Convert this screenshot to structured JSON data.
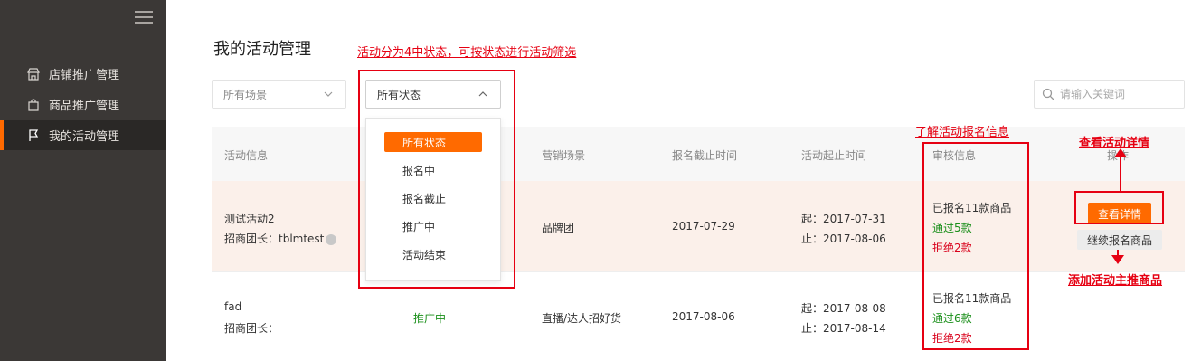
{
  "sidebar": {
    "items": [
      {
        "label": "店铺推广管理",
        "icon": "store-icon"
      },
      {
        "label": "商品推广管理",
        "icon": "bag-icon"
      },
      {
        "label": "我的活动管理",
        "icon": "flag-icon"
      }
    ]
  },
  "page": {
    "title": "我的活动管理"
  },
  "annotations": {
    "filter_note": "活动分为4中状态，可按状态进行活动筛选",
    "audit_note": "了解活动报名信息",
    "detail_note": "查看活动详情",
    "add_note": "添加活动主推商品"
  },
  "filters": {
    "scene": "所有场景",
    "status": "所有状态",
    "search_placeholder": "请输入关键词"
  },
  "status_options": [
    "所有状态",
    "报名中",
    "报名截止",
    "推广中",
    "活动结束"
  ],
  "table": {
    "headers": {
      "info": "活动信息",
      "scene": "营销场景",
      "deadline": "报名截止时间",
      "period": "活动起止时间",
      "audit": "审核信息",
      "action": "操作"
    },
    "rows": [
      {
        "name": "测试活动2",
        "leader": "招商团长：tblmtest",
        "status": "",
        "scene": "品牌团",
        "deadline": "2017-07-29",
        "start": "起：2017-07-31",
        "end": "止：2017-08-06",
        "registered": "已报名11款商品",
        "passed": "通过5款",
        "rejected": "拒绝2款",
        "view_button": "查看详情",
        "continue_button": "继续报名商品"
      },
      {
        "name": "fad",
        "leader": "招商团长：",
        "status": "推广中",
        "scene": "直播/达人招好货",
        "deadline": "2017-08-06",
        "start": "起：2017-08-08",
        "end": "止：2017-08-14",
        "registered": "已报名11款商品",
        "passed": "通过6款",
        "rejected": "拒绝2款"
      }
    ]
  },
  "colors": {
    "sidebar_bg": "#3b3836",
    "accent": "#ff6a00",
    "annotation_red": "#e60012",
    "pass_green": "#1a8f1a",
    "reject_red": "#d9001b"
  }
}
